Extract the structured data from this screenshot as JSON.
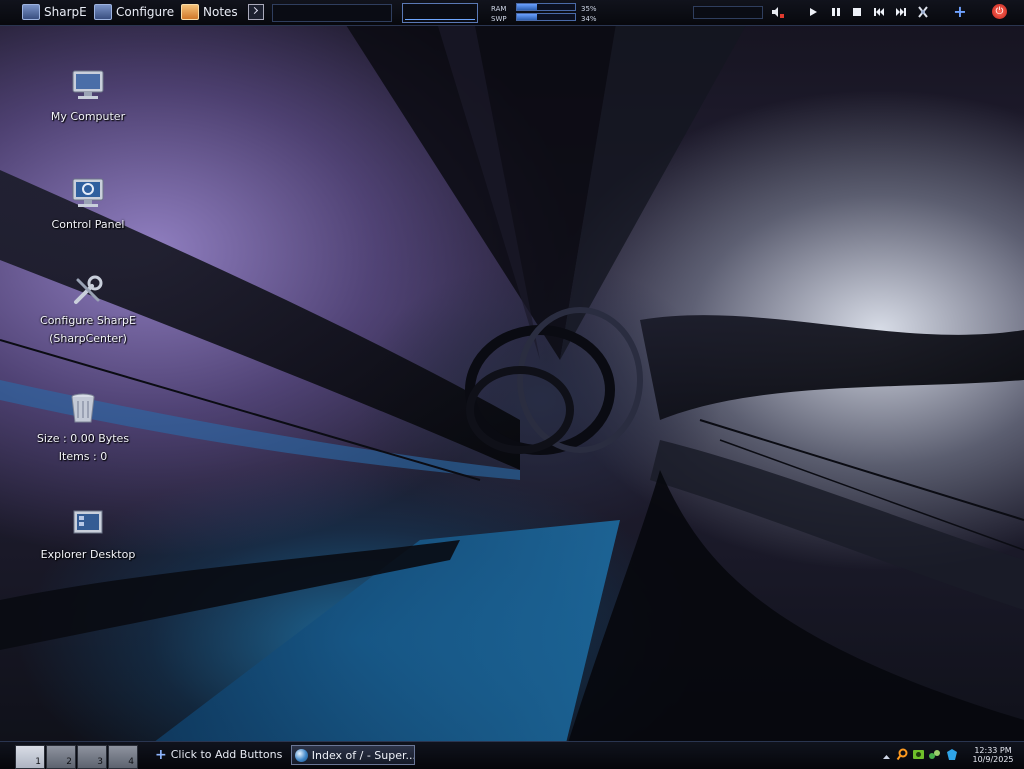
{
  "topbar": {
    "menu_sharpe": "SharpE",
    "menu_configure": "Configure",
    "menu_notes": "Notes",
    "ram_label": "RAM",
    "swp_label": "SWP",
    "ram_percent": "35%",
    "swp_percent": "34%",
    "ram_fraction": 0.35,
    "swp_fraction": 0.34
  },
  "desktop": {
    "icons": [
      {
        "label": "My Computer",
        "icon": "computer-icon"
      },
      {
        "label": "Control Panel",
        "icon": "control-panel-icon"
      },
      {
        "label": "Configure SharpE",
        "label2": "(SharpCenter)",
        "icon": "tools-icon"
      },
      {
        "label": "Size : 0.00 Bytes",
        "label2": "Items : 0",
        "icon": "recycle-bin-icon"
      },
      {
        "label": "Explorer Desktop",
        "icon": "explorer-desktop-icon"
      }
    ]
  },
  "taskbar": {
    "workspaces": [
      "1",
      "2",
      "3",
      "4"
    ],
    "add_buttons_label": "Click to Add Buttons",
    "task_item_label": "Index of / - Super...",
    "clock_time": "12:33 PM",
    "clock_date": "10/9/2025"
  },
  "colors": {
    "accent": "#5a78b5",
    "power": "#c4231a"
  }
}
